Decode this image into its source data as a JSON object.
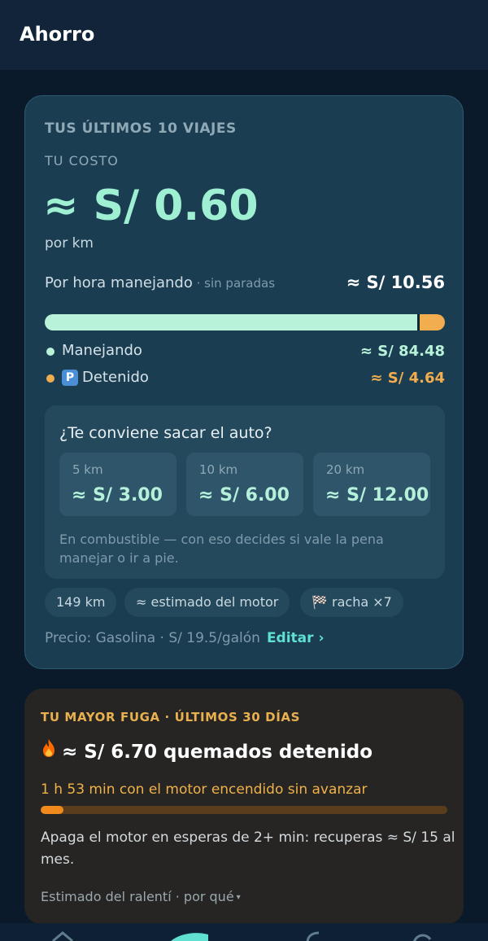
{
  "header": {
    "title": "Ahorro"
  },
  "summary": {
    "eyebrow": "TUS ÚLTIMOS 10 VIAJES",
    "cost_label": "TU COSTO",
    "cost_value": "≈ S/ 0.60",
    "cost_unit": "por km",
    "hourly": {
      "label": "Por hora manejando",
      "sublabel": " · sin paradas",
      "value": "≈ S/ 10.56"
    },
    "split": {
      "driving_fraction": 0.93,
      "driving": {
        "label": "Manejando",
        "value": "≈ S/ 84.48",
        "color": "#b8f2d8"
      },
      "stopped": {
        "badge": "P",
        "label": "Detenido",
        "value": "≈ S/ 4.64",
        "color": "#f2ad4e"
      }
    },
    "worth_it": {
      "title": "¿Te conviene sacar el auto?",
      "options": [
        {
          "distance": "5 km",
          "cost": "≈ S/ 3.00"
        },
        {
          "distance": "10 km",
          "cost": "≈ S/ 6.00"
        },
        {
          "distance": "20 km",
          "cost": "≈ S/ 12.00"
        }
      ],
      "note": "En combustible — con eso decides si vale la pena manejar o ir a pie."
    },
    "chips": [
      "149 km",
      "≈ estimado del motor",
      "🏁 racha ×7"
    ],
    "price": {
      "text": "Precio: Gasolina · S/ 19.5/galón",
      "edit_label": "Editar ›"
    }
  },
  "leak": {
    "eyebrow": "TU MAYOR FUGA · ÚLTIMOS 30 DÍAS",
    "icon": "fire-icon",
    "title": "≈ S/ 6.70 quemados detenido",
    "subtitle": "1 h 53 min con el motor encendido sin avanzar",
    "idle_fraction": 0.055,
    "advice": "Apaga el motor en esperas de 2+ min: recuperas ≈ S/ 15 al mes.",
    "footer": "Estimado del ralentí · por qué"
  },
  "nav": {
    "icons": [
      "home-icon",
      "leaf-icon",
      "fuel-icon",
      "history-icon"
    ]
  },
  "colors": {
    "accent": "#9ff0d3",
    "warning": "#f2ad4e",
    "link": "#5fe0d0"
  }
}
